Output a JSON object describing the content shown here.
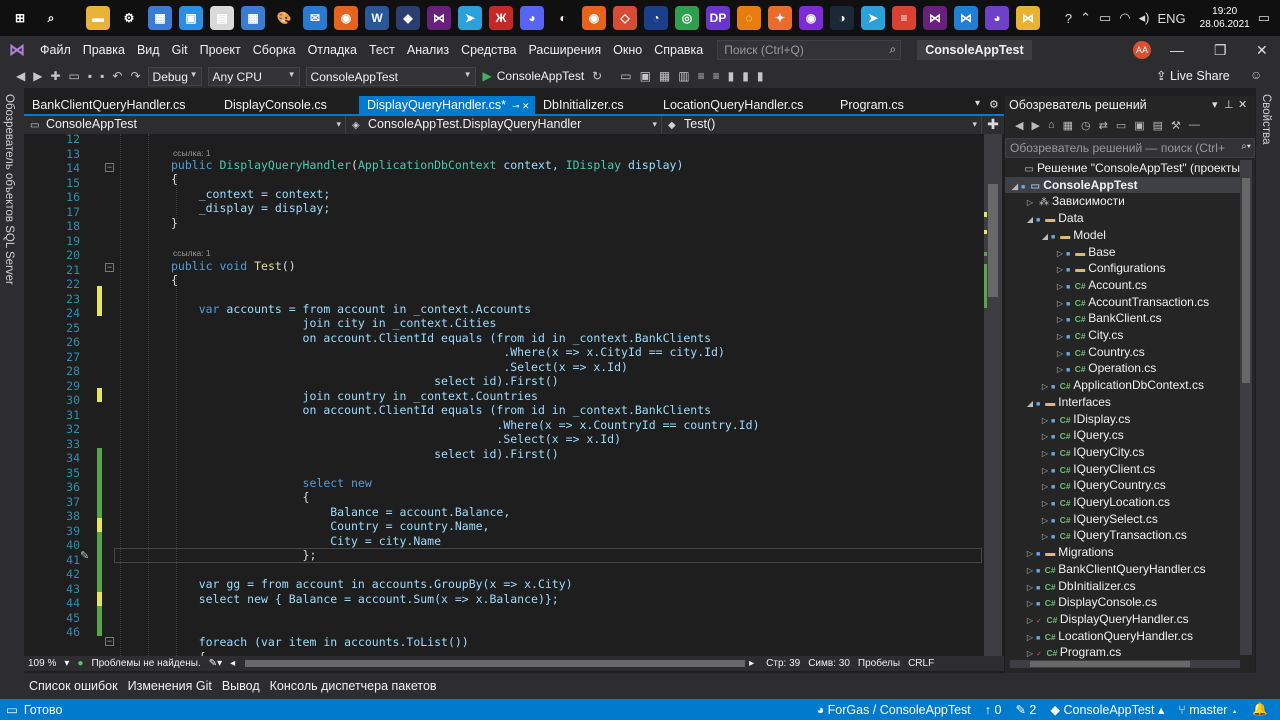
{
  "taskbar": {
    "icons": [
      {
        "name": "windows-start-icon",
        "color": "#101010",
        "glyph": "⊞"
      },
      {
        "name": "search-icon",
        "color": "#101010",
        "glyph": "⌕"
      },
      {
        "name": "file-explorer-icon",
        "color": "#e8b339",
        "glyph": "▬"
      },
      {
        "name": "settings-gear-icon",
        "color": "#101010",
        "glyph": "⚙"
      },
      {
        "name": "control-panel-icon",
        "color": "#3b7bd3",
        "glyph": "▦"
      },
      {
        "name": "photos-icon",
        "color": "#2a8fe0",
        "glyph": "▣"
      },
      {
        "name": "document-icon",
        "color": "#d9d9d9",
        "glyph": "▤"
      },
      {
        "name": "calculator-icon",
        "color": "#3b7bd3",
        "glyph": "▦"
      },
      {
        "name": "paint-icon",
        "color": "#101010",
        "glyph": "🎨"
      },
      {
        "name": "mail-icon",
        "color": "#2a7ad2",
        "glyph": "✉"
      },
      {
        "name": "firefox-icon",
        "color": "#e5631b",
        "glyph": "◉"
      },
      {
        "name": "word-icon",
        "color": "#2b579a",
        "glyph": "W"
      },
      {
        "name": "ssms-icon",
        "color": "#2c3e70",
        "glyph": "◆"
      },
      {
        "name": "visual-studio-icon",
        "color": "#68217a",
        "glyph": "⋈"
      },
      {
        "name": "telegram-icon",
        "color": "#2aa1da",
        "glyph": "➤"
      },
      {
        "name": "app-red-icon",
        "color": "#c62828",
        "glyph": "Ж"
      },
      {
        "name": "discord-icon",
        "color": "#5865f2",
        "glyph": "◕"
      },
      {
        "name": "figma-icon",
        "color": "#101010",
        "glyph": "◐"
      },
      {
        "name": "firefox-dev-icon",
        "color": "#e5631b",
        "glyph": "◉"
      },
      {
        "name": "git-icon",
        "color": "#d64b34",
        "glyph": "◇"
      },
      {
        "name": "arc-icon",
        "color": "#1b3e8a",
        "glyph": "◔"
      },
      {
        "name": "chrome-icon",
        "color": "#2e9e4f",
        "glyph": "◎"
      },
      {
        "name": "dp-icon",
        "color": "#6a36c9",
        "glyph": "DP"
      },
      {
        "name": "blender-icon",
        "color": "#e87d0d",
        "glyph": "◌"
      },
      {
        "name": "compass-icon",
        "color": "#e96c2c",
        "glyph": "✦"
      },
      {
        "name": "podcast-icon",
        "color": "#7c2bd6",
        "glyph": "◉"
      },
      {
        "name": "steam-icon",
        "color": "#1b2838",
        "glyph": "◑"
      },
      {
        "name": "telegram-icon-2",
        "color": "#2aa1da",
        "glyph": "➤"
      },
      {
        "name": "todoist-icon",
        "color": "#db4035",
        "glyph": "≡"
      },
      {
        "name": "visual-studio-icon-2",
        "color": "#68217a",
        "glyph": "⋈"
      },
      {
        "name": "vscode-icon",
        "color": "#1f7fd6",
        "glyph": "⋈"
      },
      {
        "name": "github-icon",
        "color": "#6e40c9",
        "glyph": "◕"
      },
      {
        "name": "kali-icon",
        "color": "#e7b332",
        "glyph": "⋈"
      }
    ],
    "tray": {
      "help_glyph": "?",
      "chevron_glyph": "⌃",
      "lang": "ENG",
      "time": "19:20",
      "date": "28.06.2021"
    }
  },
  "menubar": {
    "items": [
      "Файл",
      "Правка",
      "Вид",
      "Git",
      "Проект",
      "Сборка",
      "Отладка",
      "Тест",
      "Анализ",
      "Средства",
      "Расширения",
      "Окно",
      "Справка"
    ],
    "search_placeholder": "Поиск (Ctrl+Q)",
    "solution_title": "ConsoleAppTest",
    "avatar": "AA"
  },
  "toolbar": {
    "config": "Debug",
    "platform": "Any CPU",
    "startup_project": "ConsoleAppTest",
    "run_label": "ConsoleAppTest",
    "live_share": "Live Share"
  },
  "left_strip": "Обозреватель объектов SQL Server",
  "right_strip": "Свойства",
  "doc_tabs": [
    {
      "label": "BankClientQueryHandler.cs",
      "active": false
    },
    {
      "label": "DisplayConsole.cs",
      "active": false
    },
    {
      "label": "DisplayQueryHandler.cs*",
      "active": true
    },
    {
      "label": "DbInitializer.cs",
      "active": false
    },
    {
      "label": "LocationQueryHandler.cs",
      "active": false
    },
    {
      "label": "Program.cs",
      "active": false
    }
  ],
  "navbar": {
    "project": "ConsoleAppTest",
    "class": "ConsoleAppTest.DisplayQueryHandler",
    "member": "Test()"
  },
  "editor": {
    "ref_label": "ссылка: 1",
    "line_numbers": [
      "12",
      "13",
      "14",
      "15",
      "16",
      "17",
      "18",
      "19",
      "20",
      "21",
      "22",
      "23",
      "24",
      "25",
      "26",
      "27",
      "28",
      "29",
      "30",
      "31",
      "32",
      "33",
      "34",
      "35",
      "36",
      "37",
      "38",
      "39",
      "40",
      "41",
      "42",
      "43",
      "44",
      "45",
      "46"
    ],
    "lines": {
      "l13a": "public ",
      "l13b": "DisplayQueryHandler",
      "l13c": "(",
      "l13d": "ApplicationDbContext",
      "l13e": " context, ",
      "l13f": "IDisplay",
      "l13g": " display)",
      "l14": "{",
      "l15": "    _context = context;",
      "l16": "    _display = display;",
      "l17": "}",
      "l19a": "public void ",
      "l19b": "Test",
      "l19c": "()",
      "l20": "{",
      "l22a": "    var ",
      "l22b": "accounts",
      "l22c": " = from account in _context.Accounts",
      "l23": "                   join city in _context.Cities",
      "l24": "                   on account.ClientId equals (from id in _context.BankClients",
      "l25": "                                                .Where(x => x.CityId == city.Id)",
      "l26": "                                                .Select(x => x.Id)",
      "l27": "                                      select id).First()",
      "l28": "                   join country in _context.Countries",
      "l29": "                   on account.ClientId equals (from id in _context.BankClients",
      "l30": "                                               .Where(x => x.CountryId == country.Id)",
      "l31": "                                               .Select(x => x.Id)",
      "l32": "                                      select id).First()",
      "l34": "                   select new",
      "l35": "                   {",
      "l36": "                       Balance = account.Balance,",
      "l37": "                       Country = country.Name,",
      "l38": "                       City = city.Name",
      "l39": "                   };",
      "l41": "    var gg = from account in accounts.GroupBy(x => x.City)",
      "l42": "    select new { Balance = account.Sum(x => x.Balance)};",
      "l45": "    foreach (var item in accounts.ToList())",
      "l46": "    {"
    }
  },
  "editor_status": {
    "zoom": "109 %",
    "problems": "Проблемы не найдены.",
    "line": "Стр: 39",
    "col": "Симв: 30",
    "spaces": "Пробелы",
    "eol": "CRLF"
  },
  "solution_explorer": {
    "title": "Обозреватель решений",
    "search_placeholder": "Обозреватель решений — поиск (Ctrl+",
    "tree": [
      {
        "label": "Решение \"ConsoleAppTest\" (проекты",
        "depth": 0,
        "icon": "solution",
        "tri": "",
        "lock": ""
      },
      {
        "label": "ConsoleAppTest",
        "depth": 0,
        "icon": "project",
        "tri": "◢",
        "lock": "blue",
        "selected": true
      },
      {
        "label": "Зависимости",
        "depth": 1,
        "icon": "dependencies",
        "tri": "▷",
        "lock": ""
      },
      {
        "label": "Data",
        "depth": 1,
        "icon": "folder",
        "tri": "◢",
        "lock": "blue"
      },
      {
        "label": "Model",
        "depth": 2,
        "icon": "folder",
        "tri": "◢",
        "lock": "blue"
      },
      {
        "label": "Base",
        "depth": 3,
        "icon": "folder",
        "tri": "▷",
        "lock": "blue"
      },
      {
        "label": "Configurations",
        "depth": 3,
        "icon": "folder",
        "tri": "▷",
        "lock": "blue"
      },
      {
        "label": "Account.cs",
        "depth": 3,
        "icon": "cs",
        "tri": "▷",
        "lock": "blue"
      },
      {
        "label": "AccountTransaction.cs",
        "depth": 3,
        "icon": "cs",
        "tri": "▷",
        "lock": "blue"
      },
      {
        "label": "BankClient.cs",
        "depth": 3,
        "icon": "cs",
        "tri": "▷",
        "lock": "blue"
      },
      {
        "label": "City.cs",
        "depth": 3,
        "icon": "cs",
        "tri": "▷",
        "lock": "blue"
      },
      {
        "label": "Country.cs",
        "depth": 3,
        "icon": "cs",
        "tri": "▷",
        "lock": "blue"
      },
      {
        "label": "Operation.cs",
        "depth": 3,
        "icon": "cs",
        "tri": "▷",
        "lock": "blue"
      },
      {
        "label": "ApplicationDbContext.cs",
        "depth": 2,
        "icon": "cs",
        "tri": "▷",
        "lock": "blue"
      },
      {
        "label": "Interfaces",
        "depth": 1,
        "icon": "folder",
        "tri": "◢",
        "lock": "blue"
      },
      {
        "label": "IDisplay.cs",
        "depth": 2,
        "icon": "cs",
        "tri": "▷",
        "lock": "blue"
      },
      {
        "label": "IQuery.cs",
        "depth": 2,
        "icon": "cs",
        "tri": "▷",
        "lock": "blue"
      },
      {
        "label": "IQueryCity.cs",
        "depth": 2,
        "icon": "cs",
        "tri": "▷",
        "lock": "blue"
      },
      {
        "label": "IQueryClient.cs",
        "depth": 2,
        "icon": "cs",
        "tri": "▷",
        "lock": "blue"
      },
      {
        "label": "IQueryCountry.cs",
        "depth": 2,
        "icon": "cs",
        "tri": "▷",
        "lock": "blue"
      },
      {
        "label": "IQueryLocation.cs",
        "depth": 2,
        "icon": "cs",
        "tri": "▷",
        "lock": "blue"
      },
      {
        "label": "IQuerySelect.cs",
        "depth": 2,
        "icon": "cs",
        "tri": "▷",
        "lock": "blue"
      },
      {
        "label": "IQueryTransaction.cs",
        "depth": 2,
        "icon": "cs",
        "tri": "▷",
        "lock": "blue"
      },
      {
        "label": "Migrations",
        "depth": 1,
        "icon": "folder",
        "tri": "▷",
        "lock": "blue"
      },
      {
        "label": "BankClientQueryHandler.cs",
        "depth": 1,
        "icon": "cs",
        "tri": "▷",
        "lock": "blue"
      },
      {
        "label": "DbInitializer.cs",
        "depth": 1,
        "icon": "cs",
        "tri": "▷",
        "lock": "blue"
      },
      {
        "label": "DisplayConsole.cs",
        "depth": 1,
        "icon": "cs",
        "tri": "▷",
        "lock": "blue"
      },
      {
        "label": "DisplayQueryHandler.cs",
        "depth": 1,
        "icon": "cs",
        "tri": "▷",
        "lock": "red"
      },
      {
        "label": "LocationQueryHandler.cs",
        "depth": 1,
        "icon": "cs",
        "tri": "▷",
        "lock": "blue"
      },
      {
        "label": "Program.cs",
        "depth": 1,
        "icon": "cs",
        "tri": "▷",
        "lock": "red"
      }
    ]
  },
  "bottom_tabs": [
    "Список ошибок",
    "Изменения Git",
    "Вывод",
    "Консоль диспетчера пакетов"
  ],
  "statusbar": {
    "ready": "Готово",
    "repo": "ForGas / ConsoleAppTest",
    "up_count": "0",
    "edits_count": "2",
    "project": "ConsoleAppTest",
    "branch": "master"
  },
  "colors": {
    "accent": "#007acc",
    "keyword": "#569cd6",
    "type": "#4ec9b0",
    "method": "#dcdcaa",
    "line_number": "#2b91af"
  }
}
